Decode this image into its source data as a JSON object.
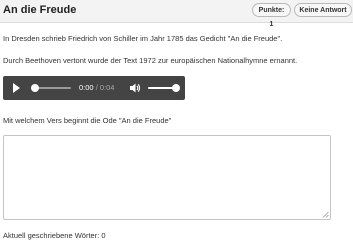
{
  "header": {
    "title": "An die Freude",
    "points_label": "Punkte: 1",
    "no_answer_label": "Keine Antwort"
  },
  "content": {
    "paragraph1": "In Dresden schrieb Friedrich von Schiller im Jahr 1785 das Gedicht \"An die Freude\".",
    "paragraph2": "Durch Beethoven vertont wurde der Text 1972 zur europäischen Nationalhymne ernannt."
  },
  "audio": {
    "current_time": "0:00",
    "separator": " / ",
    "duration": "0:04",
    "progress": 0,
    "volume": 1.0,
    "icons": [
      "play-icon",
      "volume-icon"
    ]
  },
  "question": {
    "text": "Mit welchem Vers beginnt die Ode \"An die Freude\"",
    "answer_value": ""
  },
  "footer": {
    "word_count_label": "Aktuell geschriebene Wörter: 0"
  }
}
